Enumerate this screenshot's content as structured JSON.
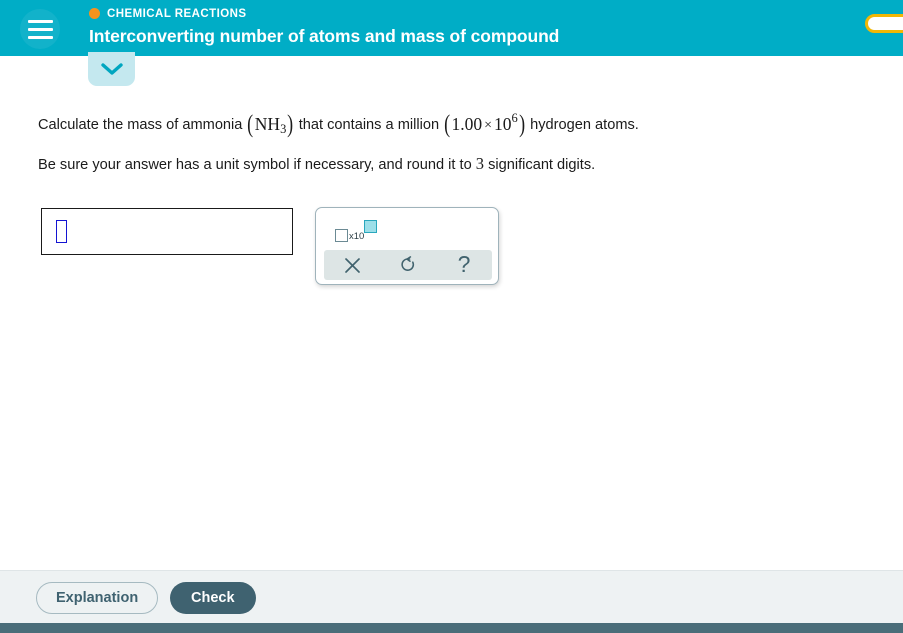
{
  "header": {
    "menu_icon": "hamburger-menu-icon",
    "eyebrow_dot_color": "#f5931e",
    "eyebrow": "CHEMICAL REACTIONS",
    "title": "Interconverting number of atoms and mass of compound",
    "background_color": "#00adc6",
    "score_pill": {
      "border_color": "#f2b705",
      "fill_color": "#ffffff"
    }
  },
  "collapse_tab": {
    "icon": "chevron-down-icon",
    "background_color": "#c4e8ef",
    "icon_color": "#00a6c0"
  },
  "question": {
    "line1": {
      "part1": "Calculate the mass of ammonia",
      "formula_open": "(",
      "formula_element": "NH",
      "formula_subscript": "3",
      "formula_close": ")",
      "part2": "that contains a million",
      "value_open": "(",
      "value_mantissa": "1.00",
      "value_times": "×",
      "value_base": "10",
      "value_exponent": "6",
      "value_close": ")",
      "part3": "hydrogen atoms."
    },
    "line2": {
      "part1": "Be sure your answer has a unit symbol if necessary, and round it to",
      "sig_digits": "3",
      "part2": "significant digits."
    }
  },
  "answer": {
    "value": "",
    "placeholder": "",
    "caret_color": "#1414d2",
    "border_color": "#1a1a1a"
  },
  "palette": {
    "sci_notation": {
      "name": "scientific-notation-key",
      "label": "x10",
      "base_box": "",
      "exponent_box": "",
      "exponent_fill_color": "#9ddfe9",
      "exponent_border_color": "#2aa7bd"
    },
    "tools": [
      {
        "name": "clear-button",
        "icon": "x-icon",
        "label": "×"
      },
      {
        "name": "undo-button",
        "icon": "undo-icon",
        "label": "↺"
      },
      {
        "name": "help-button",
        "icon": "question-mark-icon",
        "label": "?"
      }
    ],
    "toolbar_color": "#dde5e5"
  },
  "footer": {
    "explanation_label": "Explanation",
    "check_label": "Check",
    "check_color": "#3f6270",
    "background_color": "#eef2f3"
  },
  "bottom_bar": {
    "color": "#4a6d79"
  }
}
